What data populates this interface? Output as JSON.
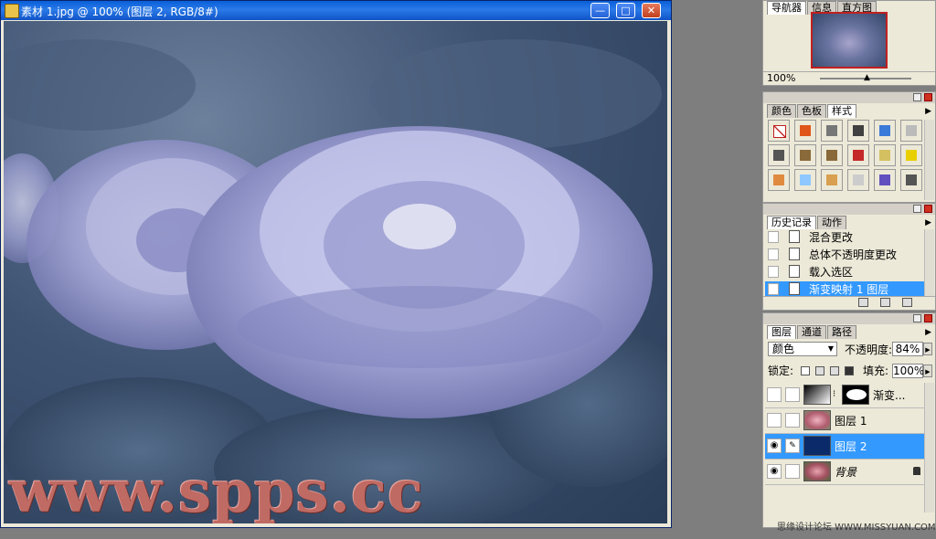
{
  "document": {
    "title": "素材 1.jpg @ 100% (图层 2, RGB/8#)",
    "minimize": "—",
    "maximize": "□",
    "close": "✕",
    "watermark": "www.spps.cc"
  },
  "navigator": {
    "tabs": [
      "导航器",
      "信息",
      "直方图"
    ],
    "zoom": "100%"
  },
  "styles": {
    "tabs": [
      "颜色",
      "色板",
      "样式"
    ],
    "swatches": [
      "#ffffff",
      "#e0561a",
      "#777777",
      "#404040",
      "#3a7ad8",
      "#bbbbbb",
      "#555555",
      "#8a6a3a",
      "#8a6a3a",
      "#c42828",
      "#d4c060",
      "#e8d000",
      "#e08a40",
      "#8fc8ff",
      "#d8a050",
      "#cccccc",
      "#6050c0",
      "#555555"
    ]
  },
  "history": {
    "tabs": [
      "历史记录",
      "动作"
    ],
    "items": [
      "混合更改",
      "总体不透明度更改",
      "载入选区",
      "渐变映射 1 图层"
    ],
    "selected_index": 3
  },
  "layers": {
    "tabs": [
      "图层",
      "通道",
      "路径"
    ],
    "blend_mode": "颜色",
    "opacity_label": "不透明度:",
    "opacity": "84%",
    "lock_label": "锁定:",
    "fill_label": "填充:",
    "fill": "100%",
    "items": [
      {
        "name": "渐变...",
        "visible": false,
        "selected": false
      },
      {
        "name": "图层 1",
        "visible": false,
        "selected": false
      },
      {
        "name": "图层 2",
        "visible": true,
        "selected": true
      },
      {
        "name": "背景",
        "visible": true,
        "selected": false
      }
    ]
  },
  "footer": {
    "site": "思缘设计论坛 WWW.MISSYUAN.COM"
  }
}
